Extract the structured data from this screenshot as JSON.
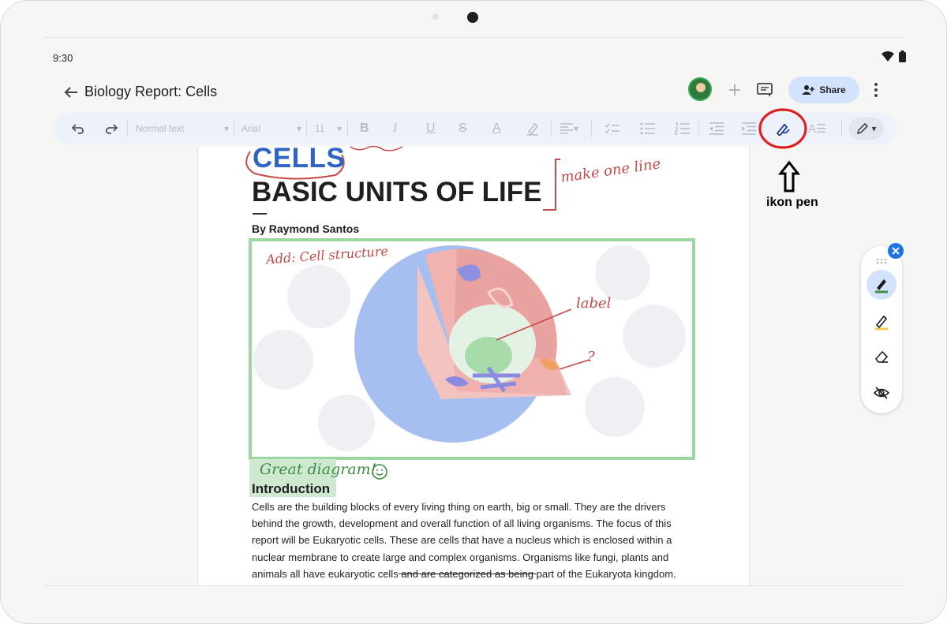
{
  "status_bar": {
    "time": "9:30"
  },
  "header": {
    "title": "Biology Report: Cells",
    "share_label": "Share"
  },
  "toolbar": {
    "style_label": "Normal text",
    "font_label": "Arial",
    "size_label": "11"
  },
  "document": {
    "title_word": "CELLS",
    "title": "BASIC UNITS OF LIFE",
    "byline": "By Raymond Santos",
    "intro_heading": "Introduction",
    "body_before_strike": "Cells are the building blocks of every living thing on earth, big or small. They are the drivers behind the growth, development and overall function of all living organisms. The focus of this report will be Eukaryotic cells. These are cells that have a nucleus which is enclosed within a nuclear membrane to create large and complex organisms. Organisms like fungi, plants and animals all have eukaryotic cells",
    "body_struck": " and are categorized as being ",
    "body_after_strike": "part of the Eukaryota kingdom."
  },
  "handwriting": {
    "make_one_line": "make one line",
    "add_cell_structure": "Add: Cell structure",
    "label": "label",
    "question": "?",
    "great_diagram": "Great diagram!"
  },
  "annotation": {
    "text": "ikon pen"
  },
  "colors": {
    "accent": "#1a73e8",
    "share_bg": "#d3e3fd",
    "toolbar_bg": "#edf2fa",
    "annotation_red": "#e02020",
    "diagram_border": "#9ed6a2"
  }
}
